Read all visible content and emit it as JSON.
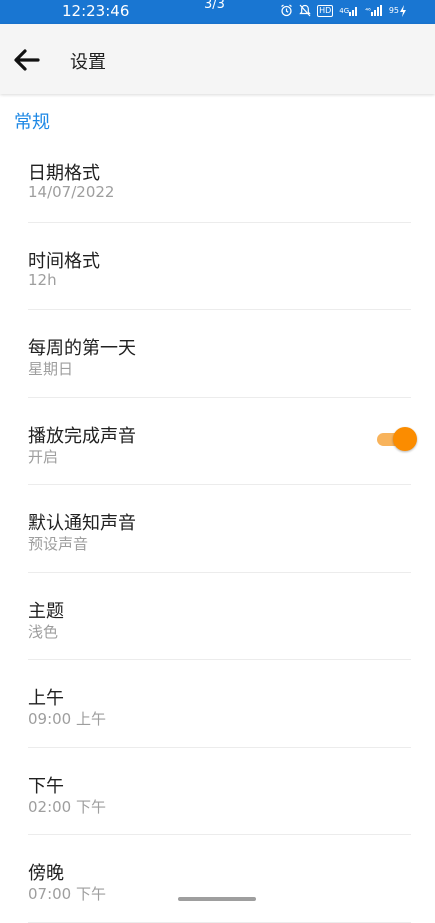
{
  "status_bar": {
    "time": "12:23:46",
    "page_indicator": "3/3",
    "icons": [
      "alarm-icon",
      "mute-icon",
      "hd-icon",
      "signal-4g-icon",
      "signal-4g-icon",
      "battery-charging-icon"
    ],
    "hd_label": "HD",
    "net1_label": "4G",
    "net2_label": "⁴⁶",
    "battery_label": "95"
  },
  "app_bar": {
    "title": "设置",
    "back_icon": "arrow-left-icon"
  },
  "section": {
    "title": "常规"
  },
  "settings": [
    {
      "title": "日期格式",
      "value": "14/07/2022"
    },
    {
      "title": "时间格式",
      "value": "12h"
    },
    {
      "title": "每周的第一天",
      "value": "星期日"
    },
    {
      "title": "播放完成声音",
      "value": "开启",
      "toggle_on": true
    },
    {
      "title": "默认通知声音",
      "value": "预设声音"
    },
    {
      "title": "主题",
      "value": "浅色"
    },
    {
      "title": "上午",
      "value": "09:00 上午"
    },
    {
      "title": "下午",
      "value": "02:00 下午"
    },
    {
      "title": "傍晚",
      "value": "07:00 下午"
    }
  ],
  "colors": {
    "status_bar": "#1976d2",
    "accent": "#1e88e5",
    "toggle_thumb": "#fb8c00",
    "toggle_track": "#f8b35b"
  }
}
